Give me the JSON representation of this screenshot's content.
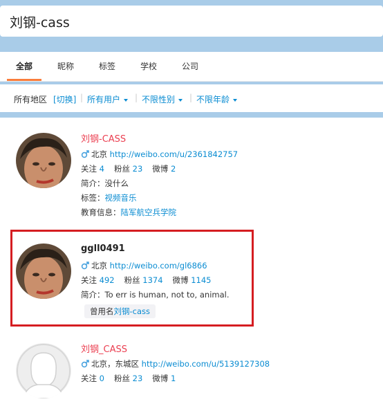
{
  "search": {
    "query": "刘钢-cass"
  },
  "tabs": [
    {
      "label": "全部"
    },
    {
      "label": "昵称"
    },
    {
      "label": "标签"
    },
    {
      "label": "学校"
    },
    {
      "label": "公司"
    }
  ],
  "filters": {
    "region": "所有地区",
    "switch": "[切换]",
    "users": "所有用户",
    "gender": "不限性别",
    "age": "不限年龄",
    "separator": "|"
  },
  "results": [
    {
      "name": "刘钢-CASS",
      "location": "北京",
      "url": "http://weibo.com/u/2361842757",
      "follow_label": "关注",
      "follow": "4",
      "fans_label": "粉丝",
      "fans": "23",
      "weibo_label": "微博",
      "weibo": "2",
      "bio": "简介：没什么",
      "tags_label": "标签：",
      "tags": "视频音乐",
      "edu_label": "教育信息：",
      "edu": "陆军航空兵学院"
    },
    {
      "name": "ggll0491",
      "location": "北京",
      "url": "http://weibo.com/gl6866",
      "follow_label": "关注",
      "follow": "492",
      "fans_label": "粉丝",
      "fans": "1374",
      "weibo_label": "微博",
      "weibo": "1145",
      "bio": "简介：To err is human, not to, animal.",
      "former_label": "曾用名",
      "former_name": "刘钢-cass"
    },
    {
      "name": "刘钢_CASS",
      "location": "北京，东城区",
      "url": "http://weibo.com/u/5139127308",
      "follow_label": "关注",
      "follow": "0",
      "fans_label": "粉丝",
      "fans": "23",
      "weibo_label": "微博",
      "weibo": "1"
    }
  ],
  "colors": {
    "accent": "#fa7d3c",
    "link": "#0a8cd2",
    "name_red": "#eb3e50",
    "highlight": "#d51d21"
  },
  "icons": [
    "male-icon"
  ]
}
